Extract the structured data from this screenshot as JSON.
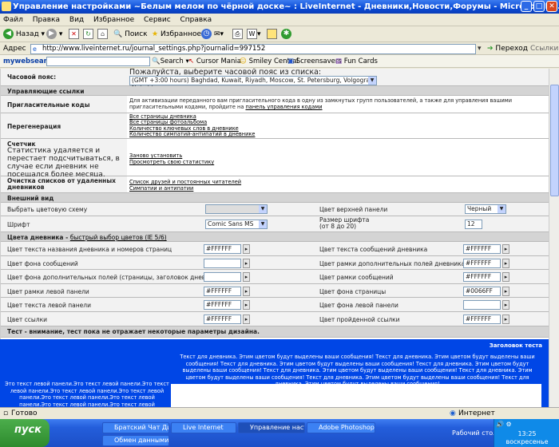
{
  "window": {
    "title": "Управление настройками ~Белым мелом по чёрной доске~ : LiveInternet - Дневники,Новости,Форумы - Microsoft Int..."
  },
  "menu": [
    "Файл",
    "Правка",
    "Вид",
    "Избранное",
    "Сервис",
    "Справка"
  ],
  "toolbar": {
    "back": "Назад",
    "search": "Поиск",
    "favorites": "Избранное"
  },
  "address": {
    "label": "Адрес",
    "url": "http://www.liveinternet.ru/journal_settings.php?journalid=997152",
    "go": "Переход",
    "links": "Ссылки"
  },
  "websearch": {
    "brand": "mywebsearch",
    "search": "Search",
    "items": [
      "Cursor Mania",
      "Smiley Central",
      "Screensavers",
      "Fun Cards"
    ]
  },
  "settings": {
    "timezone_label": "Часовой пояс:",
    "timezone_prompt": "Пожалуйста, выберите часовой пояс из списка:",
    "timezone_value": "(GMT +3:00 hours) Baghdad, Kuwait, Riyadh, Moscow, St. Petersburg, Volgograd, Nairobi",
    "control_links_header": "Управляющие ссылки",
    "invite_label": "Пригласительные коды",
    "invite_text": "Для активизации переданного вам пригласительного кода в одну из замкнутых групп пользователей, а также для управления вашими пригласительными кодами, пройдите на",
    "invite_link": "панель управления кодами",
    "regen_label": "Перегенерация",
    "regen_links": [
      "Все страницы дневника",
      "Все страницы фотоальбома",
      "Количество ключевых слов в дневнике",
      "Количество симпатий-антипатий в дневнике"
    ],
    "counter_label": "Счетчик",
    "counter_note": "Статистика удаляется и перестает подсчитываться, в случае если дневник не посещался более месяца.",
    "counter_links": [
      "Заново установить",
      "Просмотреть свою статистику"
    ],
    "clear_label": "Очистка списков от удаленных дневников",
    "clear_links": [
      "Список друзей и постоянных читателей",
      "Симпатии и антипатии"
    ],
    "appearance_header": "Внешний вид",
    "scheme_label": "Выбрать цветовую схему",
    "top_panel_color_label": "Цвет верхней панели",
    "top_panel_color_value": "Черный",
    "font_label": "Шрифт",
    "font_value": "Comic Sans MS",
    "font_size_label": "Размер шрифта",
    "font_size_range": "(от 8 до 20)",
    "font_size_value": "12",
    "colors_header": "Цвета дневника",
    "colors_header_link": "быстрый выбор цветов (IE 5/6)",
    "colors": [
      {
        "left_label": "Цвет текста названия дневника и номеров страниц",
        "left_value": "#FFFFFF",
        "right_label": "Цвет текста сообщений дневника",
        "right_value": "#FFFFFF"
      },
      {
        "left_label": "Цвет фона сообщений",
        "left_value": "",
        "right_label": "Цвет рамки дополнительных полей дневника",
        "right_value": "#FFFFFF"
      },
      {
        "left_label": "Цвет фона дополнительных полей (страницы, заголовок дневника)",
        "left_value": "",
        "right_label": "Цвет рамки сообщений",
        "right_value": "#FFFFFF"
      },
      {
        "left_label": "Цвет рамки левой панели",
        "left_value": "#FFFFFF",
        "right_label": "Цвет фона страницы",
        "right_value": "#0066FF"
      },
      {
        "left_label": "Цвет текста левой панели",
        "left_value": "#FFFFFF",
        "right_label": "Цвет фона левой панели",
        "right_value": ""
      },
      {
        "left_label": "Цвет ссылки",
        "left_value": "#FFFFFF",
        "right_label": "Цвет пройденной ссылки",
        "right_value": "#FFFFFF"
      }
    ],
    "test_header": "Тест - внимание, тест пока не отражает некоторые параметры дизайна.",
    "preview_title": "Заголовок теста",
    "preview_message": "Текст для дневника. Этим цветом будут выделены ваши сообщения! Текст для дневника. Этим цветом будут выделены ваши сообщения! Текст для дневника. Этим цветом будут выделены ваши сообщения! Текст для дневника. Этим цветом будут выделены ваши сообщения! Текст для дневника. Этим цветом будут выделены ваши сообщения! Текст для дневника. Этим цветом будут выделены ваши сообщения! Текст для дневника. Этим цветом будут выделены ваши сообщения! Текст для дневника. Этим цветом будут выделены ваши сообщения!",
    "preview_left": "Это текст левой панели.Это текст левой панели.Это текст левой панели.Это текст левой панели.Это текст левой панели.Это текст левой панели.Это текст левой панели.Это текст левой панели.Это текст левой панели.Это текст левой панели.Это текст левой панели.Это текст левой панели."
  },
  "status": {
    "left": "Готово",
    "zone": "Интернет"
  },
  "taskbar": {
    "start": "пуск",
    "tasks": [
      "Братский Чат Ди...",
      "Live Internet",
      "Управление наст...",
      "Adobe Photoshop ...",
      "Обмен данными с..."
    ],
    "desktop": "Рабочий стол",
    "clock": "13:25",
    "day": "воскресенье"
  }
}
